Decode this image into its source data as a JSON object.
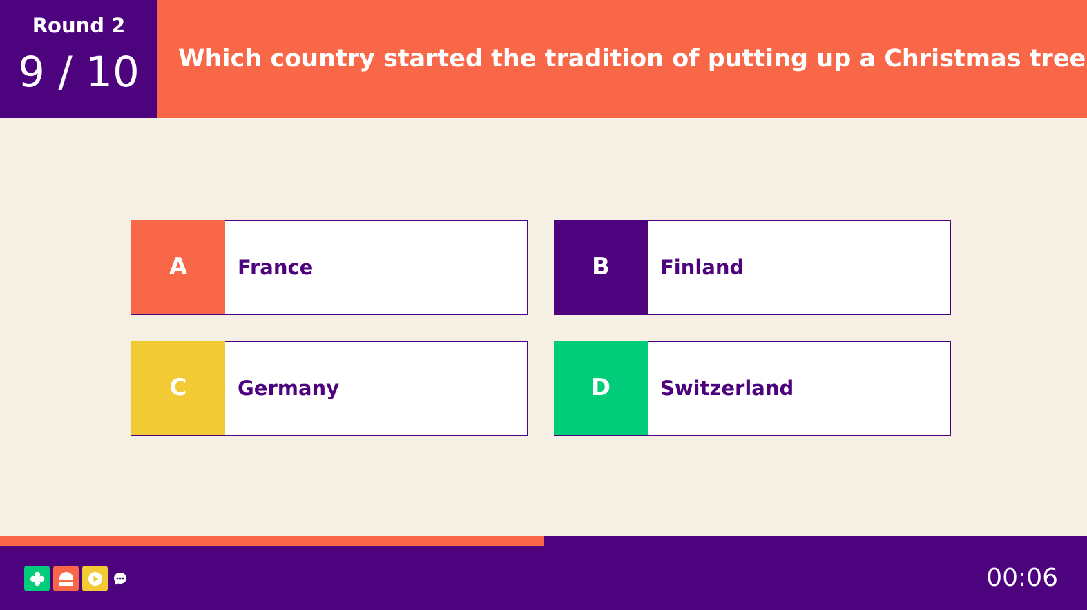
{
  "header": {
    "round_label": "Round 2",
    "question_progress": "9 / 10",
    "question": "Which country started the tradition of putting up a Christmas tree?"
  },
  "answers": [
    {
      "letter": "A",
      "text": "France",
      "color": "#F86747"
    },
    {
      "letter": "B",
      "text": "Finland",
      "color": "#4D037E"
    },
    {
      "letter": "C",
      "text": "Germany",
      "color": "#F2CB34"
    },
    {
      "letter": "D",
      "text": "Switzerland",
      "color": "#00CC79"
    }
  ],
  "timer": {
    "remaining": "00:06",
    "progress_fraction": 0.5
  },
  "footer": {
    "logo_icons": [
      "flower-icon",
      "arch-icon",
      "play-icon",
      "chat-bubble-icon"
    ]
  },
  "colors": {
    "primary": "#4D037E",
    "accent": "#F86747",
    "background": "#F6EFE4"
  }
}
